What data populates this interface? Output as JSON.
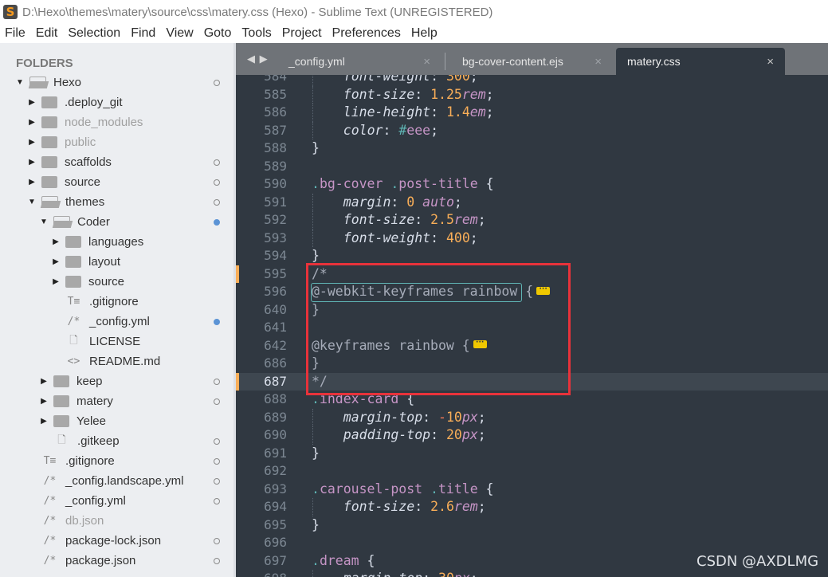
{
  "window": {
    "title": "D:\\Hexo\\themes\\matery\\source\\css\\matery.css (Hexo) - Sublime Text (UNREGISTERED)",
    "app_icon": "sublime-text-logo",
    "app_icon_glyph": "S"
  },
  "menu": [
    "File",
    "Edit",
    "Selection",
    "Find",
    "View",
    "Goto",
    "Tools",
    "Project",
    "Preferences",
    "Help"
  ],
  "sidebar": {
    "header": "FOLDERS",
    "items": [
      {
        "label": "Hexo",
        "type": "folder",
        "open": true,
        "level": 0,
        "status": "clean",
        "dim": false
      },
      {
        "label": ".deploy_git",
        "type": "folder",
        "open": false,
        "level": 1,
        "status": "none",
        "dim": false
      },
      {
        "label": "node_modules",
        "type": "folder",
        "open": false,
        "level": 1,
        "status": "none",
        "dim": true
      },
      {
        "label": "public",
        "type": "folder",
        "open": false,
        "level": 1,
        "status": "none",
        "dim": true
      },
      {
        "label": "scaffolds",
        "type": "folder",
        "open": false,
        "level": 1,
        "status": "clean",
        "dim": false
      },
      {
        "label": "source",
        "type": "folder",
        "open": false,
        "level": 1,
        "status": "clean",
        "dim": false
      },
      {
        "label": "themes",
        "type": "folder",
        "open": true,
        "level": 1,
        "status": "clean",
        "dim": false
      },
      {
        "label": "Coder",
        "type": "folder",
        "open": true,
        "level": 2,
        "status": "modified",
        "dim": false
      },
      {
        "label": "languages",
        "type": "folder",
        "open": false,
        "level": 3,
        "status": "none",
        "dim": false
      },
      {
        "label": "layout",
        "type": "folder",
        "open": false,
        "level": 3,
        "status": "none",
        "dim": false
      },
      {
        "label": "source",
        "type": "folder",
        "open": false,
        "level": 3,
        "status": "none",
        "dim": false
      },
      {
        "label": ".gitignore",
        "type": "file",
        "glyph": "T≡",
        "icon": "text-file-icon",
        "level": 3,
        "status": "none",
        "dim": false
      },
      {
        "label": "_config.yml",
        "type": "file",
        "glyph": "/*",
        "icon": "code-file-icon",
        "level": 3,
        "status": "modified",
        "dim": false
      },
      {
        "label": "LICENSE",
        "type": "file",
        "glyph": "🗋",
        "icon": "plain-file-icon",
        "level": 3,
        "status": "none",
        "dim": false
      },
      {
        "label": "README.md",
        "type": "file",
        "glyph": "<>",
        "icon": "markup-file-icon",
        "level": 3,
        "status": "none",
        "dim": false
      },
      {
        "label": "keep",
        "type": "folder",
        "open": false,
        "level": 2,
        "status": "clean",
        "dim": false
      },
      {
        "label": "matery",
        "type": "folder",
        "open": false,
        "level": 2,
        "status": "clean",
        "dim": false
      },
      {
        "label": "Yelee",
        "type": "folder",
        "open": false,
        "level": 2,
        "status": "none",
        "dim": false
      },
      {
        "label": ".gitkeep",
        "type": "file",
        "glyph": "🗋",
        "icon": "plain-file-icon",
        "level": 2,
        "status": "clean",
        "dim": false
      },
      {
        "label": ".gitignore",
        "type": "file",
        "glyph": "T≡",
        "icon": "text-file-icon",
        "level": 1,
        "status": "clean",
        "dim": false
      },
      {
        "label": "_config.landscape.yml",
        "type": "file",
        "glyph": "/*",
        "icon": "code-file-icon",
        "level": 1,
        "status": "clean",
        "dim": false
      },
      {
        "label": "_config.yml",
        "type": "file",
        "glyph": "/*",
        "icon": "code-file-icon",
        "level": 1,
        "status": "clean",
        "dim": false
      },
      {
        "label": "db.json",
        "type": "file",
        "glyph": "/*",
        "icon": "code-file-icon",
        "level": 1,
        "status": "none",
        "dim": true
      },
      {
        "label": "package-lock.json",
        "type": "file",
        "glyph": "/*",
        "icon": "code-file-icon",
        "level": 1,
        "status": "clean",
        "dim": false
      },
      {
        "label": "package.json",
        "type": "file",
        "glyph": "/*",
        "icon": "code-file-icon",
        "level": 1,
        "status": "clean",
        "dim": false
      }
    ]
  },
  "tabs": {
    "nav": "◀ ▶",
    "close_glyph": "×",
    "items": [
      {
        "label": "_config.yml",
        "active": false
      },
      {
        "label": "bg-cover-content.ejs",
        "active": false
      },
      {
        "label": "matery.css",
        "active": true
      }
    ]
  },
  "editor": {
    "current_line": "687",
    "lines": [
      {
        "n": "584",
        "indent": 1,
        "tokens": [
          [
            "t-prop",
            "font-weight"
          ],
          [
            "t-punct",
            ": "
          ],
          [
            "t-num",
            "300"
          ],
          [
            "t-punct",
            ";"
          ]
        ]
      },
      {
        "n": "585",
        "indent": 1,
        "tokens": [
          [
            "t-prop",
            "font-size"
          ],
          [
            "t-punct",
            ": "
          ],
          [
            "t-num",
            "1.25"
          ],
          [
            "t-unit",
            "rem"
          ],
          [
            "t-punct",
            ";"
          ]
        ]
      },
      {
        "n": "586",
        "indent": 1,
        "tokens": [
          [
            "t-prop",
            "line-height"
          ],
          [
            "t-punct",
            ": "
          ],
          [
            "t-num",
            "1.4"
          ],
          [
            "t-unit",
            "em"
          ],
          [
            "t-punct",
            ";"
          ]
        ]
      },
      {
        "n": "587",
        "indent": 1,
        "tokens": [
          [
            "t-prop",
            "color"
          ],
          [
            "t-punct",
            ": "
          ],
          [
            "t-hash",
            "#"
          ],
          [
            "t-sel",
            "eee"
          ],
          [
            "t-punct",
            ";"
          ]
        ]
      },
      {
        "n": "588",
        "indent": 0,
        "tokens": [
          [
            "t-punct",
            "}"
          ]
        ]
      },
      {
        "n": "589",
        "indent": 0,
        "tokens": []
      },
      {
        "n": "590",
        "indent": 0,
        "tokens": [
          [
            "t-sel-dot",
            "."
          ],
          [
            "t-sel",
            "bg-cover"
          ],
          [
            "t-punct",
            " "
          ],
          [
            "t-sel-dot",
            "."
          ],
          [
            "t-sel",
            "post-title"
          ],
          [
            "t-punct",
            " {"
          ]
        ]
      },
      {
        "n": "591",
        "indent": 1,
        "tokens": [
          [
            "t-prop",
            "margin"
          ],
          [
            "t-punct",
            ": "
          ],
          [
            "t-num",
            "0"
          ],
          [
            "t-punct",
            " "
          ],
          [
            "t-kw",
            "auto"
          ],
          [
            "t-punct",
            ";"
          ]
        ]
      },
      {
        "n": "592",
        "indent": 1,
        "tokens": [
          [
            "t-prop",
            "font-size"
          ],
          [
            "t-punct",
            ": "
          ],
          [
            "t-num",
            "2.5"
          ],
          [
            "t-unit",
            "rem"
          ],
          [
            "t-punct",
            ";"
          ]
        ]
      },
      {
        "n": "593",
        "indent": 1,
        "tokens": [
          [
            "t-prop",
            "font-weight"
          ],
          [
            "t-punct",
            ": "
          ],
          [
            "t-num",
            "400"
          ],
          [
            "t-punct",
            ";"
          ]
        ]
      },
      {
        "n": "594",
        "indent": 0,
        "tokens": [
          [
            "t-punct",
            "}"
          ]
        ]
      },
      {
        "n": "595",
        "indent": 0,
        "mark": true,
        "tokens": [
          [
            "t-comment",
            "/*"
          ]
        ]
      },
      {
        "n": "596",
        "indent": 0,
        "match": true,
        "fold": true,
        "tokens": [
          [
            "t-comment",
            "@-webkit-keyframes rainbow "
          ],
          [
            "t-comment",
            "{"
          ]
        ]
      },
      {
        "n": "640",
        "indent": 0,
        "tokens": [
          [
            "t-comment",
            "}"
          ]
        ]
      },
      {
        "n": "641",
        "indent": 0,
        "tokens": []
      },
      {
        "n": "642",
        "indent": 0,
        "fold": true,
        "tokens": [
          [
            "t-comment",
            "@keyframes rainbow {"
          ]
        ]
      },
      {
        "n": "686",
        "indent": 0,
        "tokens": [
          [
            "t-comment",
            "}"
          ]
        ]
      },
      {
        "n": "687",
        "indent": 0,
        "mark": true,
        "current": true,
        "tokens": [
          [
            "t-comment",
            "*/"
          ]
        ]
      },
      {
        "n": "688",
        "indent": 0,
        "tokens": [
          [
            "t-sel-dot",
            "."
          ],
          [
            "t-sel",
            "index-card"
          ],
          [
            "t-punct",
            " {"
          ]
        ]
      },
      {
        "n": "689",
        "indent": 1,
        "tokens": [
          [
            "t-prop",
            "margin-top"
          ],
          [
            "t-punct",
            ": "
          ],
          [
            "t-neg",
            "-"
          ],
          [
            "t-num",
            "10"
          ],
          [
            "t-unit",
            "px"
          ],
          [
            "t-punct",
            ";"
          ]
        ]
      },
      {
        "n": "690",
        "indent": 1,
        "tokens": [
          [
            "t-prop",
            "padding-top"
          ],
          [
            "t-punct",
            ": "
          ],
          [
            "t-num",
            "20"
          ],
          [
            "t-unit",
            "px"
          ],
          [
            "t-punct",
            ";"
          ]
        ]
      },
      {
        "n": "691",
        "indent": 0,
        "tokens": [
          [
            "t-punct",
            "}"
          ]
        ]
      },
      {
        "n": "692",
        "indent": 0,
        "tokens": []
      },
      {
        "n": "693",
        "indent": 0,
        "tokens": [
          [
            "t-sel-dot",
            "."
          ],
          [
            "t-sel",
            "carousel-post"
          ],
          [
            "t-punct",
            " "
          ],
          [
            "t-sel-dot",
            "."
          ],
          [
            "t-sel",
            "title"
          ],
          [
            "t-punct",
            " {"
          ]
        ]
      },
      {
        "n": "694",
        "indent": 1,
        "tokens": [
          [
            "t-prop",
            "font-size"
          ],
          [
            "t-punct",
            ": "
          ],
          [
            "t-num",
            "2.6"
          ],
          [
            "t-unit",
            "rem"
          ],
          [
            "t-punct",
            ";"
          ]
        ]
      },
      {
        "n": "695",
        "indent": 0,
        "tokens": [
          [
            "t-punct",
            "}"
          ]
        ]
      },
      {
        "n": "696",
        "indent": 0,
        "tokens": []
      },
      {
        "n": "697",
        "indent": 0,
        "tokens": [
          [
            "t-sel-dot",
            "."
          ],
          [
            "t-sel",
            "dream"
          ],
          [
            "t-punct",
            " {"
          ]
        ]
      },
      {
        "n": "698",
        "indent": 1,
        "tokens": [
          [
            "t-prop",
            "margin-top"
          ],
          [
            "t-punct",
            ": "
          ],
          [
            "t-num",
            "30"
          ],
          [
            "t-unit",
            "px"
          ],
          [
            "t-punct",
            ";"
          ]
        ]
      }
    ]
  },
  "annotation": {
    "highlight": "red-rectangle",
    "color": "#e8323a"
  },
  "watermark": "CSDN @AXDLMG",
  "colors": {
    "editor_bg": "#303841",
    "tabbar_bg": "#6f7378",
    "sidebar_bg": "#eceef1",
    "modified_dot": "#5b93d5",
    "gutter_mark": "#f9ae58",
    "number": "#f9ae58",
    "selector": "#c695c6",
    "teal": "#5fb4b4",
    "fold_marker": "#f0c800"
  }
}
